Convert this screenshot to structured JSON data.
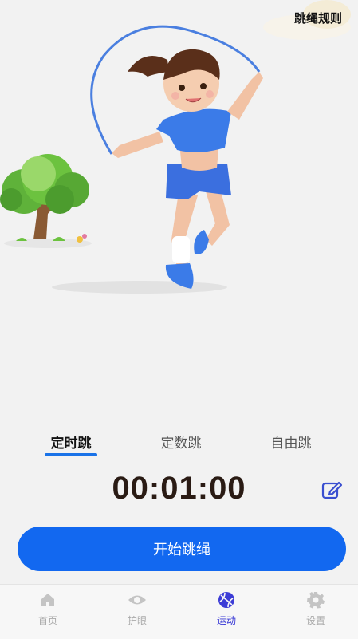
{
  "header": {
    "rules_label": "跳绳规则"
  },
  "hero": {
    "illustration": "girl-jumping-rope-with-tree"
  },
  "mode_tabs": [
    {
      "label": "定时跳",
      "active": true
    },
    {
      "label": "定数跳",
      "active": false
    },
    {
      "label": "自由跳",
      "active": false
    }
  ],
  "timer": {
    "value": "00:01:00"
  },
  "actions": {
    "start_label": "开始跳绳",
    "edit_icon": "edit-icon"
  },
  "bottom_nav": [
    {
      "label": "首页",
      "icon": "home-icon",
      "active": false
    },
    {
      "label": "护眼",
      "icon": "eye-icon",
      "active": false
    },
    {
      "label": "运动",
      "icon": "ball-icon",
      "active": true
    },
    {
      "label": "设置",
      "icon": "gear-icon",
      "active": false
    }
  ],
  "colors": {
    "accent": "#1268f0",
    "active_nav": "#3c3cd6",
    "timer_text": "#2a1b14"
  }
}
